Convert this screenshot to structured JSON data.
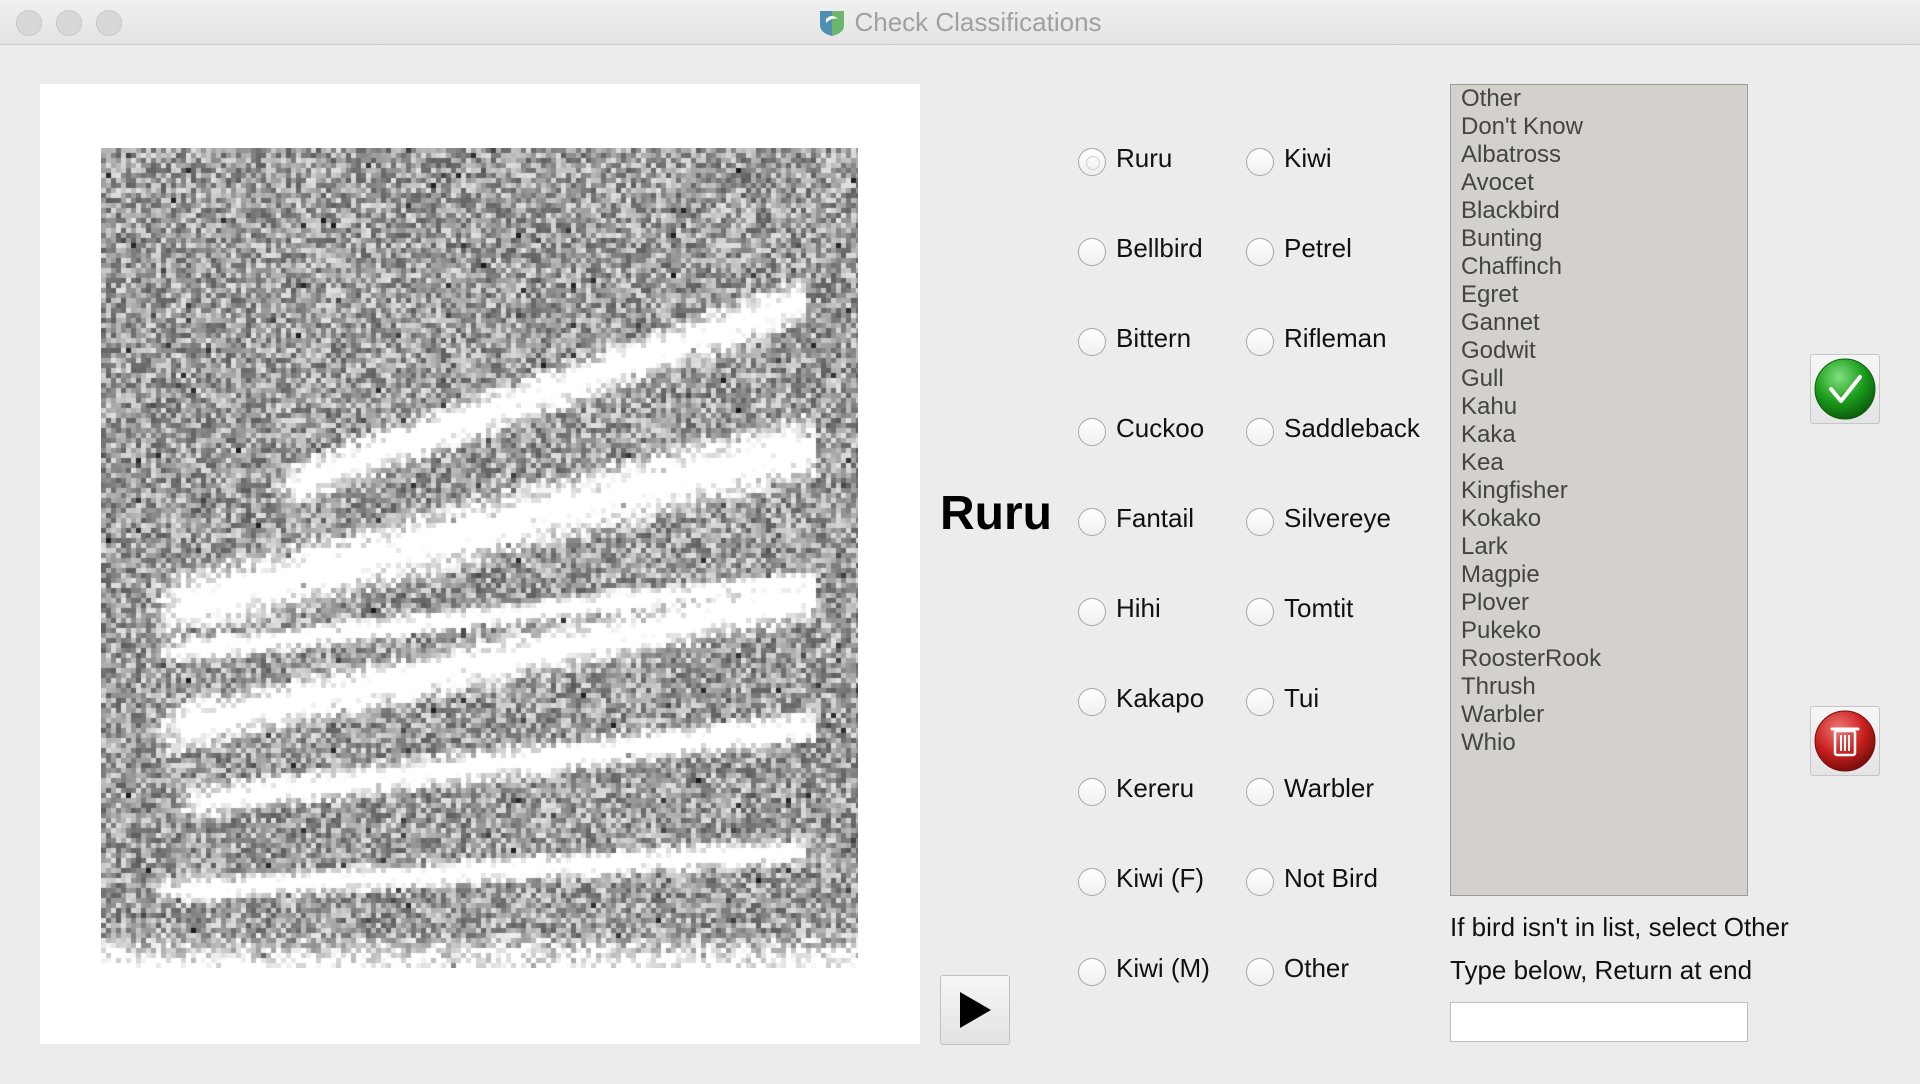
{
  "window": {
    "title": "Check Classifications",
    "app_icon": "bird-icon"
  },
  "current_classification": "Ruru",
  "radio_options_left": [
    "Ruru",
    "Bellbird",
    "Bittern",
    "Cuckoo",
    "Fantail",
    "Hihi",
    "Kakapo",
    "Kereru",
    "Kiwi (F)",
    "Kiwi (M)"
  ],
  "radio_options_right": [
    "Kiwi",
    "Petrel",
    "Rifleman",
    "Saddleback",
    "Silvereye",
    "Tomtit",
    "Tui",
    "Warbler",
    "Not Bird",
    "Other"
  ],
  "bird_list": [
    "Other",
    "Don't Know",
    "Albatross",
    "Avocet",
    "Blackbird",
    "Bunting",
    "Chaffinch",
    "Egret",
    "Gannet",
    "Godwit",
    "Gull",
    "Kahu",
    "Kaka",
    "Kea",
    "Kingfisher",
    "Kokako",
    "Lark",
    "Magpie",
    "Plover",
    "Pukeko",
    "RoosterRook",
    "Thrush",
    "Warbler",
    "Whio"
  ],
  "help": {
    "line1": "If bird isn't in list, select Other",
    "line2": "Type below, Return at end"
  },
  "other_input": {
    "value": "",
    "placeholder": ""
  },
  "buttons": {
    "play_icon": "play-icon",
    "accept_icon": "checkmark-icon",
    "delete_icon": "trash-icon"
  },
  "colors": {
    "accept": "#1a9b1a",
    "delete": "#c8201e",
    "list_bg": "#d4d0cc"
  }
}
